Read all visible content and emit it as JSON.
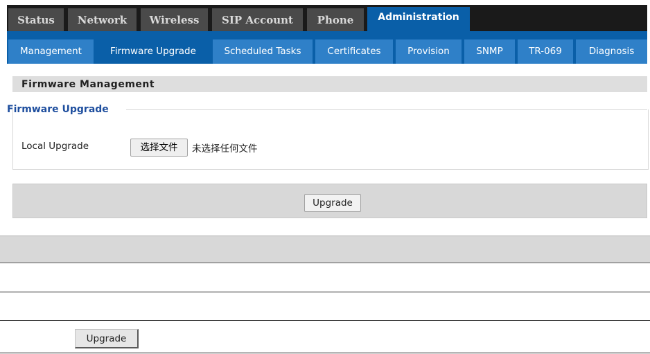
{
  "top_tabs": [
    {
      "label": "Status",
      "active": false
    },
    {
      "label": "Network",
      "active": false
    },
    {
      "label": "Wireless",
      "active": false
    },
    {
      "label": "SIP Account",
      "active": false
    },
    {
      "label": "Phone",
      "active": false
    },
    {
      "label": "Administration",
      "active": true
    }
  ],
  "sub_tabs": [
    {
      "label": "Management",
      "active": false
    },
    {
      "label": "Firmware Upgrade",
      "active": true
    },
    {
      "label": "Scheduled Tasks",
      "active": false
    },
    {
      "label": "Certificates",
      "active": false
    },
    {
      "label": "Provision",
      "active": false
    },
    {
      "label": "SNMP",
      "active": false
    },
    {
      "label": "TR-069",
      "active": false
    },
    {
      "label": "Diagnosis",
      "active": false
    }
  ],
  "section": {
    "title": "Firmware Management"
  },
  "fieldset": {
    "legend": "Firmware Upgrade",
    "local_upgrade_label": "Local Upgrade",
    "choose_file_label": "选择文件",
    "file_status": "未选择任何文件"
  },
  "upgrade_button_label": "Upgrade",
  "bottom_upgrade_button_label": "Upgrade",
  "colors": {
    "accent": "#0a5fa8",
    "subtab": "#2f80c8",
    "legend": "#1e4e9e"
  }
}
